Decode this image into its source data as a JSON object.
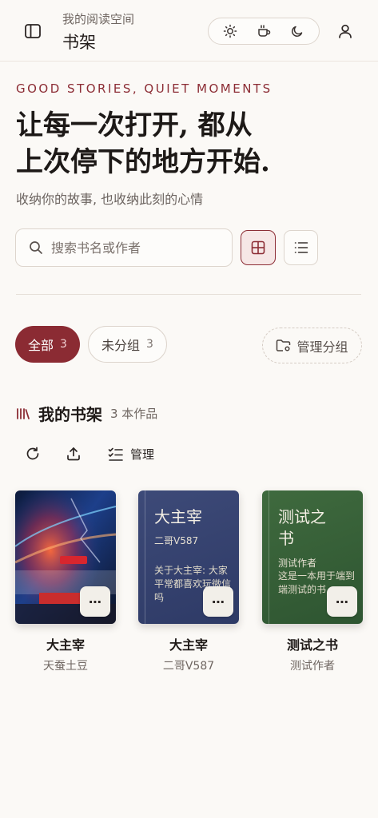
{
  "header": {
    "subtitle": "我的阅读空间",
    "title": "书架",
    "theme_options": [
      "sun-icon",
      "cup-icon",
      "moon-icon"
    ]
  },
  "hero": {
    "eyebrow": "GOOD STORIES, QUIET MOMENTS",
    "headline_line1": "让每一次打开, 都从",
    "headline_line2": "上次停下的地方开始.",
    "tagline": "收纳你的故事, 也收纳此刻的心情"
  },
  "search": {
    "placeholder": "搜索书名或作者",
    "value": ""
  },
  "view_modes": {
    "active": "grid"
  },
  "filters": {
    "all_label": "全部",
    "all_count": "3",
    "ungrouped_label": "未分组",
    "ungrouped_count": "3",
    "manage_label": "管理分组"
  },
  "shelf": {
    "title": "我的书架",
    "count": "3 本作品"
  },
  "toolbar": {
    "manage_label": "管理"
  },
  "books": [
    {
      "title": "大主宰",
      "author": "天蚕土豆",
      "cover_type": "image"
    },
    {
      "title": "大主宰",
      "author": "二哥V587",
      "cover_title": "大主宰",
      "cover_author": "二哥V587",
      "cover_desc": "关于大主宰: 大家平常都喜欢玩微信吗",
      "cover_color": "#34406e"
    },
    {
      "title": "测试之书",
      "author": "测试作者",
      "cover_title": "测试之书",
      "cover_author": "测试作者",
      "cover_desc": "这是一本用于端到端测试的书",
      "cover_color": "#36603a"
    }
  ],
  "colors": {
    "accent": "#8b2b33",
    "background": "#fbf9f6"
  }
}
